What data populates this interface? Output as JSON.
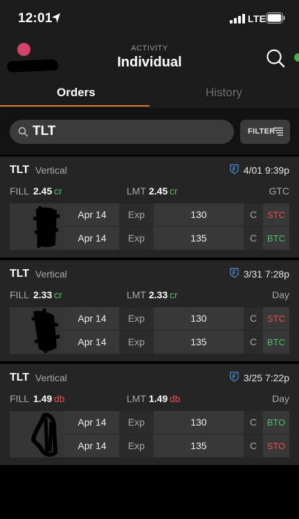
{
  "status": {
    "time": "12:01",
    "network": "LTE"
  },
  "header": {
    "eyebrow": "ACTIVITY",
    "title": "Individual"
  },
  "tabs": [
    {
      "label": "Orders",
      "active": true
    },
    {
      "label": "History",
      "active": false
    }
  ],
  "search": {
    "value": "TLT"
  },
  "filter": {
    "label": "FILTER"
  },
  "colors": {
    "accent": "#e07a33",
    "credit": "#4fc06a",
    "debit": "#e8514d",
    "avatar": "#d4426a",
    "online": "#39b54a"
  },
  "orders": [
    {
      "symbol": "TLT",
      "strategy": "Vertical",
      "datetime": "4/01 9:39p",
      "fill_label": "FILL",
      "fill_price": "2.45",
      "fill_type": "cr",
      "lmt_label": "LMT",
      "lmt_price": "2.45",
      "lmt_type": "cr",
      "tif": "GTC",
      "legs": [
        {
          "date": "Apr 14",
          "exp": "Exp",
          "strike": "130",
          "type": "C",
          "action": "STC"
        },
        {
          "date": "Apr 14",
          "exp": "Exp",
          "strike": "135",
          "type": "C",
          "action": "BTC"
        }
      ]
    },
    {
      "symbol": "TLT",
      "strategy": "Vertical",
      "datetime": "3/31 7:28p",
      "fill_label": "FILL",
      "fill_price": "2.33",
      "fill_type": "cr",
      "lmt_label": "LMT",
      "lmt_price": "2.33",
      "lmt_type": "cr",
      "tif": "Day",
      "legs": [
        {
          "date": "Apr 14",
          "exp": "Exp",
          "strike": "130",
          "type": "C",
          "action": "STC"
        },
        {
          "date": "Apr 14",
          "exp": "Exp",
          "strike": "135",
          "type": "C",
          "action": "BTC"
        }
      ]
    },
    {
      "symbol": "TLT",
      "strategy": "Vertical",
      "datetime": "3/25 7:22p",
      "fill_label": "FILL",
      "fill_price": "1.49",
      "fill_type": "db",
      "lmt_label": "LMT",
      "lmt_price": "1.49",
      "lmt_type": "db",
      "tif": "Day",
      "legs": [
        {
          "date": "Apr 14",
          "exp": "Exp",
          "strike": "130",
          "type": "C",
          "action": "BTO"
        },
        {
          "date": "Apr 14",
          "exp": "Exp",
          "strike": "135",
          "type": "C",
          "action": "STO"
        }
      ]
    }
  ]
}
